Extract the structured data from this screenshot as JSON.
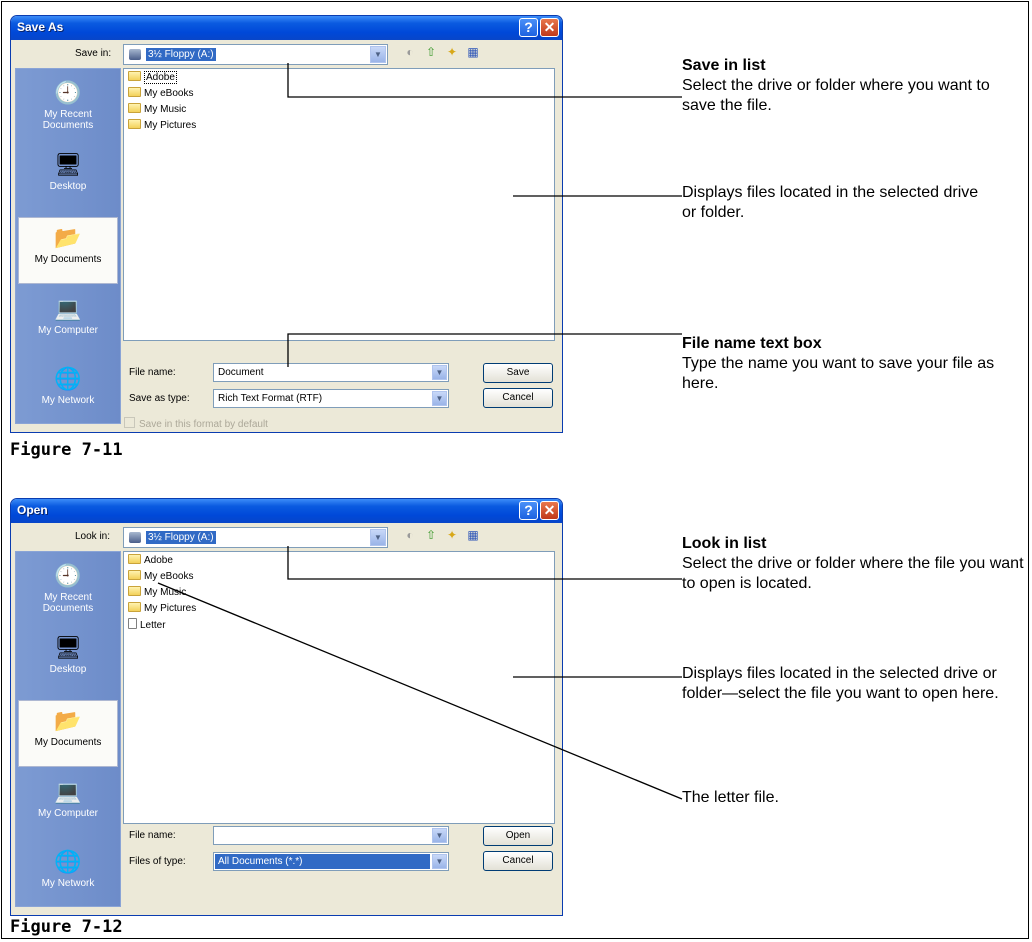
{
  "figures": [
    {
      "caption": "Figure 7-11",
      "dialog": {
        "title": "Save As",
        "location_label": "Save in:",
        "location_value": "3½ Floppy (A:)",
        "places": [
          "My Recent Documents",
          "Desktop",
          "My Documents",
          "My Computer",
          "My Network"
        ],
        "active_place": "My Documents",
        "files": [
          {
            "name": "Adobe",
            "icon": "folder-icon"
          },
          {
            "name": "My eBooks",
            "icon": "folder-icon"
          },
          {
            "name": "My Music",
            "icon": "music-folder-icon"
          },
          {
            "name": "My Pictures",
            "icon": "pictures-folder-icon"
          }
        ],
        "file_name_label": "File name:",
        "file_name_value": "Document",
        "type_label": "Save as type:",
        "type_value": "Rich Text Format (RTF)",
        "primary_button": "Save",
        "cancel_button": "Cancel",
        "checkbox_label": "Save in this format by default"
      },
      "annotations": [
        {
          "title": "Save in list",
          "text": "Select the drive or folder where you want to save the file."
        },
        {
          "title": "",
          "text": "Displays files located in the selected drive or folder."
        },
        {
          "title": "File name text box",
          "text": "Type the name you want to save your file as here."
        }
      ]
    },
    {
      "caption": "Figure 7-12",
      "dialog": {
        "title": "Open",
        "location_label": "Look in:",
        "location_value": "3½ Floppy (A:)",
        "places": [
          "My Recent Documents",
          "Desktop",
          "My Documents",
          "My Computer",
          "My Network"
        ],
        "active_place": "My Documents",
        "files": [
          {
            "name": "Adobe",
            "icon": "folder-icon"
          },
          {
            "name": "My eBooks",
            "icon": "folder-icon"
          },
          {
            "name": "My Music",
            "icon": "music-folder-icon"
          },
          {
            "name": "My Pictures",
            "icon": "pictures-folder-icon"
          },
          {
            "name": "Letter",
            "icon": "document-icon"
          }
        ],
        "file_name_label": "File name:",
        "file_name_value": "",
        "type_label": "Files of type:",
        "type_value": "All Documents (*.*)",
        "primary_button": "Open",
        "cancel_button": "Cancel"
      },
      "annotations": [
        {
          "title": "Look in list",
          "text": "Select the drive or folder where the file you want to open is located."
        },
        {
          "title": "",
          "text": "Displays files located in the selected drive or folder—select the file you want to open here."
        },
        {
          "title": "",
          "text": "The letter file."
        }
      ]
    }
  ]
}
